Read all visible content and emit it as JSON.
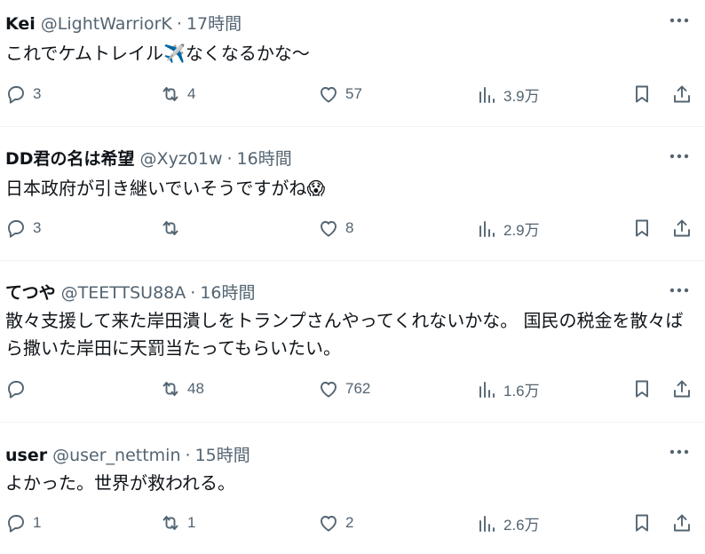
{
  "posts": [
    {
      "name": "Kei",
      "handle": "@LightWarriorK",
      "separator": "·",
      "time": "17時間",
      "text": "これでケムトレイル",
      "emoji": "✈️",
      "text_after": "なくなるかな〜",
      "replies": "3",
      "reposts": "4",
      "likes": "57",
      "views": "3.9万"
    },
    {
      "name": "DD君の名は希望",
      "handle": "@Xyz01w",
      "separator": "·",
      "time": "16時間",
      "text": "日本政府が引き継いでいそうですがね",
      "emoji": "😱",
      "text_after": "",
      "replies": "3",
      "reposts": "",
      "likes": "8",
      "views": "2.9万"
    },
    {
      "name": "てつや",
      "handle": "@TEETTSU88A",
      "separator": "·",
      "time": "16時間",
      "text": "散々支援して来た岸田潰しをトランプさんやってくれないかな。 国民の税金を散々ばら撒いた岸田に天罰当たってもらいたい。",
      "emoji": "",
      "text_after": "",
      "replies": "",
      "reposts": "48",
      "likes": "762",
      "views": "1.6万"
    },
    {
      "name": "user",
      "handle": "@user_nettmin",
      "separator": "·",
      "time": "15時間",
      "text": "よかった。世界が救われる。",
      "emoji": "",
      "text_after": "",
      "replies": "1",
      "reposts": "1",
      "likes": "2",
      "views": "2.6万"
    }
  ],
  "icons": {
    "more": "more-horizontal-icon",
    "reply": "reply-bubble-icon",
    "repost": "repost-icon",
    "like": "heart-icon",
    "views": "analytics-bars-icon",
    "bookmark": "bookmark-icon",
    "share": "share-upload-icon"
  },
  "colors": {
    "text": "#0f1419",
    "secondary": "#536471",
    "divider": "#eff3f4",
    "background": "#ffffff"
  }
}
